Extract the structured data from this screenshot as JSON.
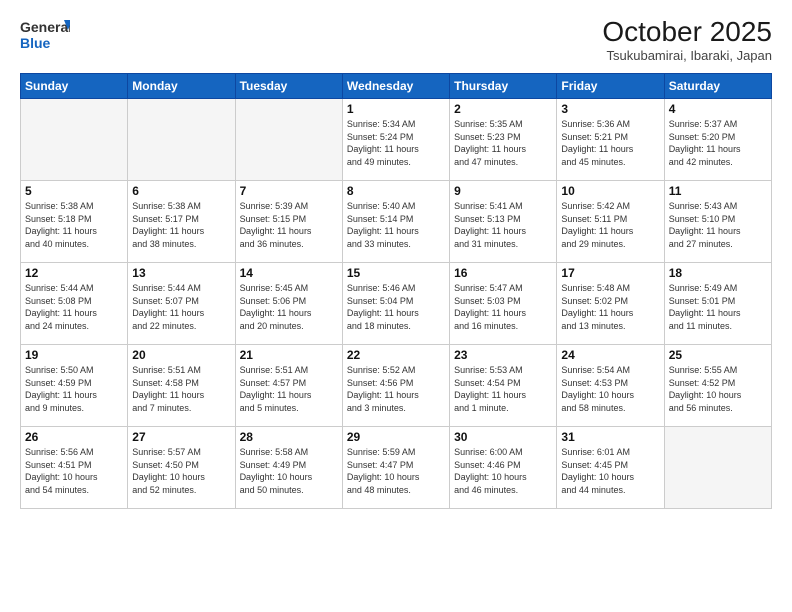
{
  "logo": {
    "line1": "General",
    "line2": "Blue"
  },
  "title": "October 2025",
  "subtitle": "Tsukubamirai, Ibaraki, Japan",
  "weekdays": [
    "Sunday",
    "Monday",
    "Tuesday",
    "Wednesday",
    "Thursday",
    "Friday",
    "Saturday"
  ],
  "weeks": [
    [
      {
        "day": "",
        "info": ""
      },
      {
        "day": "",
        "info": ""
      },
      {
        "day": "",
        "info": ""
      },
      {
        "day": "1",
        "info": "Sunrise: 5:34 AM\nSunset: 5:24 PM\nDaylight: 11 hours\nand 49 minutes."
      },
      {
        "day": "2",
        "info": "Sunrise: 5:35 AM\nSunset: 5:23 PM\nDaylight: 11 hours\nand 47 minutes."
      },
      {
        "day": "3",
        "info": "Sunrise: 5:36 AM\nSunset: 5:21 PM\nDaylight: 11 hours\nand 45 minutes."
      },
      {
        "day": "4",
        "info": "Sunrise: 5:37 AM\nSunset: 5:20 PM\nDaylight: 11 hours\nand 42 minutes."
      }
    ],
    [
      {
        "day": "5",
        "info": "Sunrise: 5:38 AM\nSunset: 5:18 PM\nDaylight: 11 hours\nand 40 minutes."
      },
      {
        "day": "6",
        "info": "Sunrise: 5:38 AM\nSunset: 5:17 PM\nDaylight: 11 hours\nand 38 minutes."
      },
      {
        "day": "7",
        "info": "Sunrise: 5:39 AM\nSunset: 5:15 PM\nDaylight: 11 hours\nand 36 minutes."
      },
      {
        "day": "8",
        "info": "Sunrise: 5:40 AM\nSunset: 5:14 PM\nDaylight: 11 hours\nand 33 minutes."
      },
      {
        "day": "9",
        "info": "Sunrise: 5:41 AM\nSunset: 5:13 PM\nDaylight: 11 hours\nand 31 minutes."
      },
      {
        "day": "10",
        "info": "Sunrise: 5:42 AM\nSunset: 5:11 PM\nDaylight: 11 hours\nand 29 minutes."
      },
      {
        "day": "11",
        "info": "Sunrise: 5:43 AM\nSunset: 5:10 PM\nDaylight: 11 hours\nand 27 minutes."
      }
    ],
    [
      {
        "day": "12",
        "info": "Sunrise: 5:44 AM\nSunset: 5:08 PM\nDaylight: 11 hours\nand 24 minutes."
      },
      {
        "day": "13",
        "info": "Sunrise: 5:44 AM\nSunset: 5:07 PM\nDaylight: 11 hours\nand 22 minutes."
      },
      {
        "day": "14",
        "info": "Sunrise: 5:45 AM\nSunset: 5:06 PM\nDaylight: 11 hours\nand 20 minutes."
      },
      {
        "day": "15",
        "info": "Sunrise: 5:46 AM\nSunset: 5:04 PM\nDaylight: 11 hours\nand 18 minutes."
      },
      {
        "day": "16",
        "info": "Sunrise: 5:47 AM\nSunset: 5:03 PM\nDaylight: 11 hours\nand 16 minutes."
      },
      {
        "day": "17",
        "info": "Sunrise: 5:48 AM\nSunset: 5:02 PM\nDaylight: 11 hours\nand 13 minutes."
      },
      {
        "day": "18",
        "info": "Sunrise: 5:49 AM\nSunset: 5:01 PM\nDaylight: 11 hours\nand 11 minutes."
      }
    ],
    [
      {
        "day": "19",
        "info": "Sunrise: 5:50 AM\nSunset: 4:59 PM\nDaylight: 11 hours\nand 9 minutes."
      },
      {
        "day": "20",
        "info": "Sunrise: 5:51 AM\nSunset: 4:58 PM\nDaylight: 11 hours\nand 7 minutes."
      },
      {
        "day": "21",
        "info": "Sunrise: 5:51 AM\nSunset: 4:57 PM\nDaylight: 11 hours\nand 5 minutes."
      },
      {
        "day": "22",
        "info": "Sunrise: 5:52 AM\nSunset: 4:56 PM\nDaylight: 11 hours\nand 3 minutes."
      },
      {
        "day": "23",
        "info": "Sunrise: 5:53 AM\nSunset: 4:54 PM\nDaylight: 11 hours\nand 1 minute."
      },
      {
        "day": "24",
        "info": "Sunrise: 5:54 AM\nSunset: 4:53 PM\nDaylight: 10 hours\nand 58 minutes."
      },
      {
        "day": "25",
        "info": "Sunrise: 5:55 AM\nSunset: 4:52 PM\nDaylight: 10 hours\nand 56 minutes."
      }
    ],
    [
      {
        "day": "26",
        "info": "Sunrise: 5:56 AM\nSunset: 4:51 PM\nDaylight: 10 hours\nand 54 minutes."
      },
      {
        "day": "27",
        "info": "Sunrise: 5:57 AM\nSunset: 4:50 PM\nDaylight: 10 hours\nand 52 minutes."
      },
      {
        "day": "28",
        "info": "Sunrise: 5:58 AM\nSunset: 4:49 PM\nDaylight: 10 hours\nand 50 minutes."
      },
      {
        "day": "29",
        "info": "Sunrise: 5:59 AM\nSunset: 4:47 PM\nDaylight: 10 hours\nand 48 minutes."
      },
      {
        "day": "30",
        "info": "Sunrise: 6:00 AM\nSunset: 4:46 PM\nDaylight: 10 hours\nand 46 minutes."
      },
      {
        "day": "31",
        "info": "Sunrise: 6:01 AM\nSunset: 4:45 PM\nDaylight: 10 hours\nand 44 minutes."
      },
      {
        "day": "",
        "info": ""
      }
    ]
  ]
}
